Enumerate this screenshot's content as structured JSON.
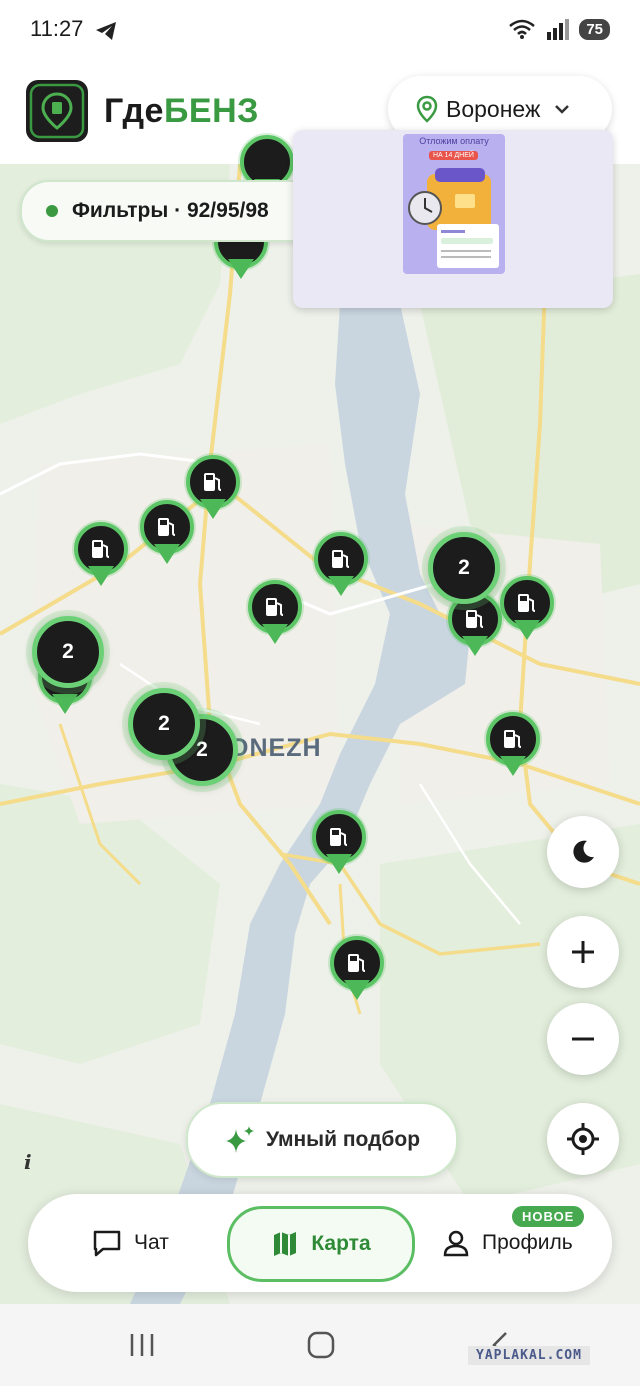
{
  "status_bar": {
    "time": "11:27",
    "signal_label": "5",
    "battery": "75"
  },
  "header": {
    "logo_icon": "fuel-pin-icon",
    "title_main": "Где",
    "title_accent": "БЕНЗ",
    "city": "Воронеж"
  },
  "filter": {
    "label": "Фильтры · 92/95/98"
  },
  "ad": {
    "headline": "Отложим оплату",
    "tag": "НА 14 ДНЕЙ"
  },
  "map": {
    "city_label": "RONEZH",
    "clusters": [
      {
        "count": "2"
      },
      {
        "count": "2"
      },
      {
        "count": "2"
      },
      {
        "count": "2"
      }
    ]
  },
  "controls": {
    "smart_button": "Умный подбор",
    "info": "i"
  },
  "bottom_nav": {
    "chat": "Чат",
    "map": "Карта",
    "profile": "Профиль",
    "profile_badge": "НОВОЕ"
  },
  "colors": {
    "brand_green": "#3a9a42",
    "pin_ring": "#5cc566",
    "pin_fill": "#1c1c1c",
    "water": "#c9d6e0"
  },
  "watermark": "YAPLAKAL.COM"
}
